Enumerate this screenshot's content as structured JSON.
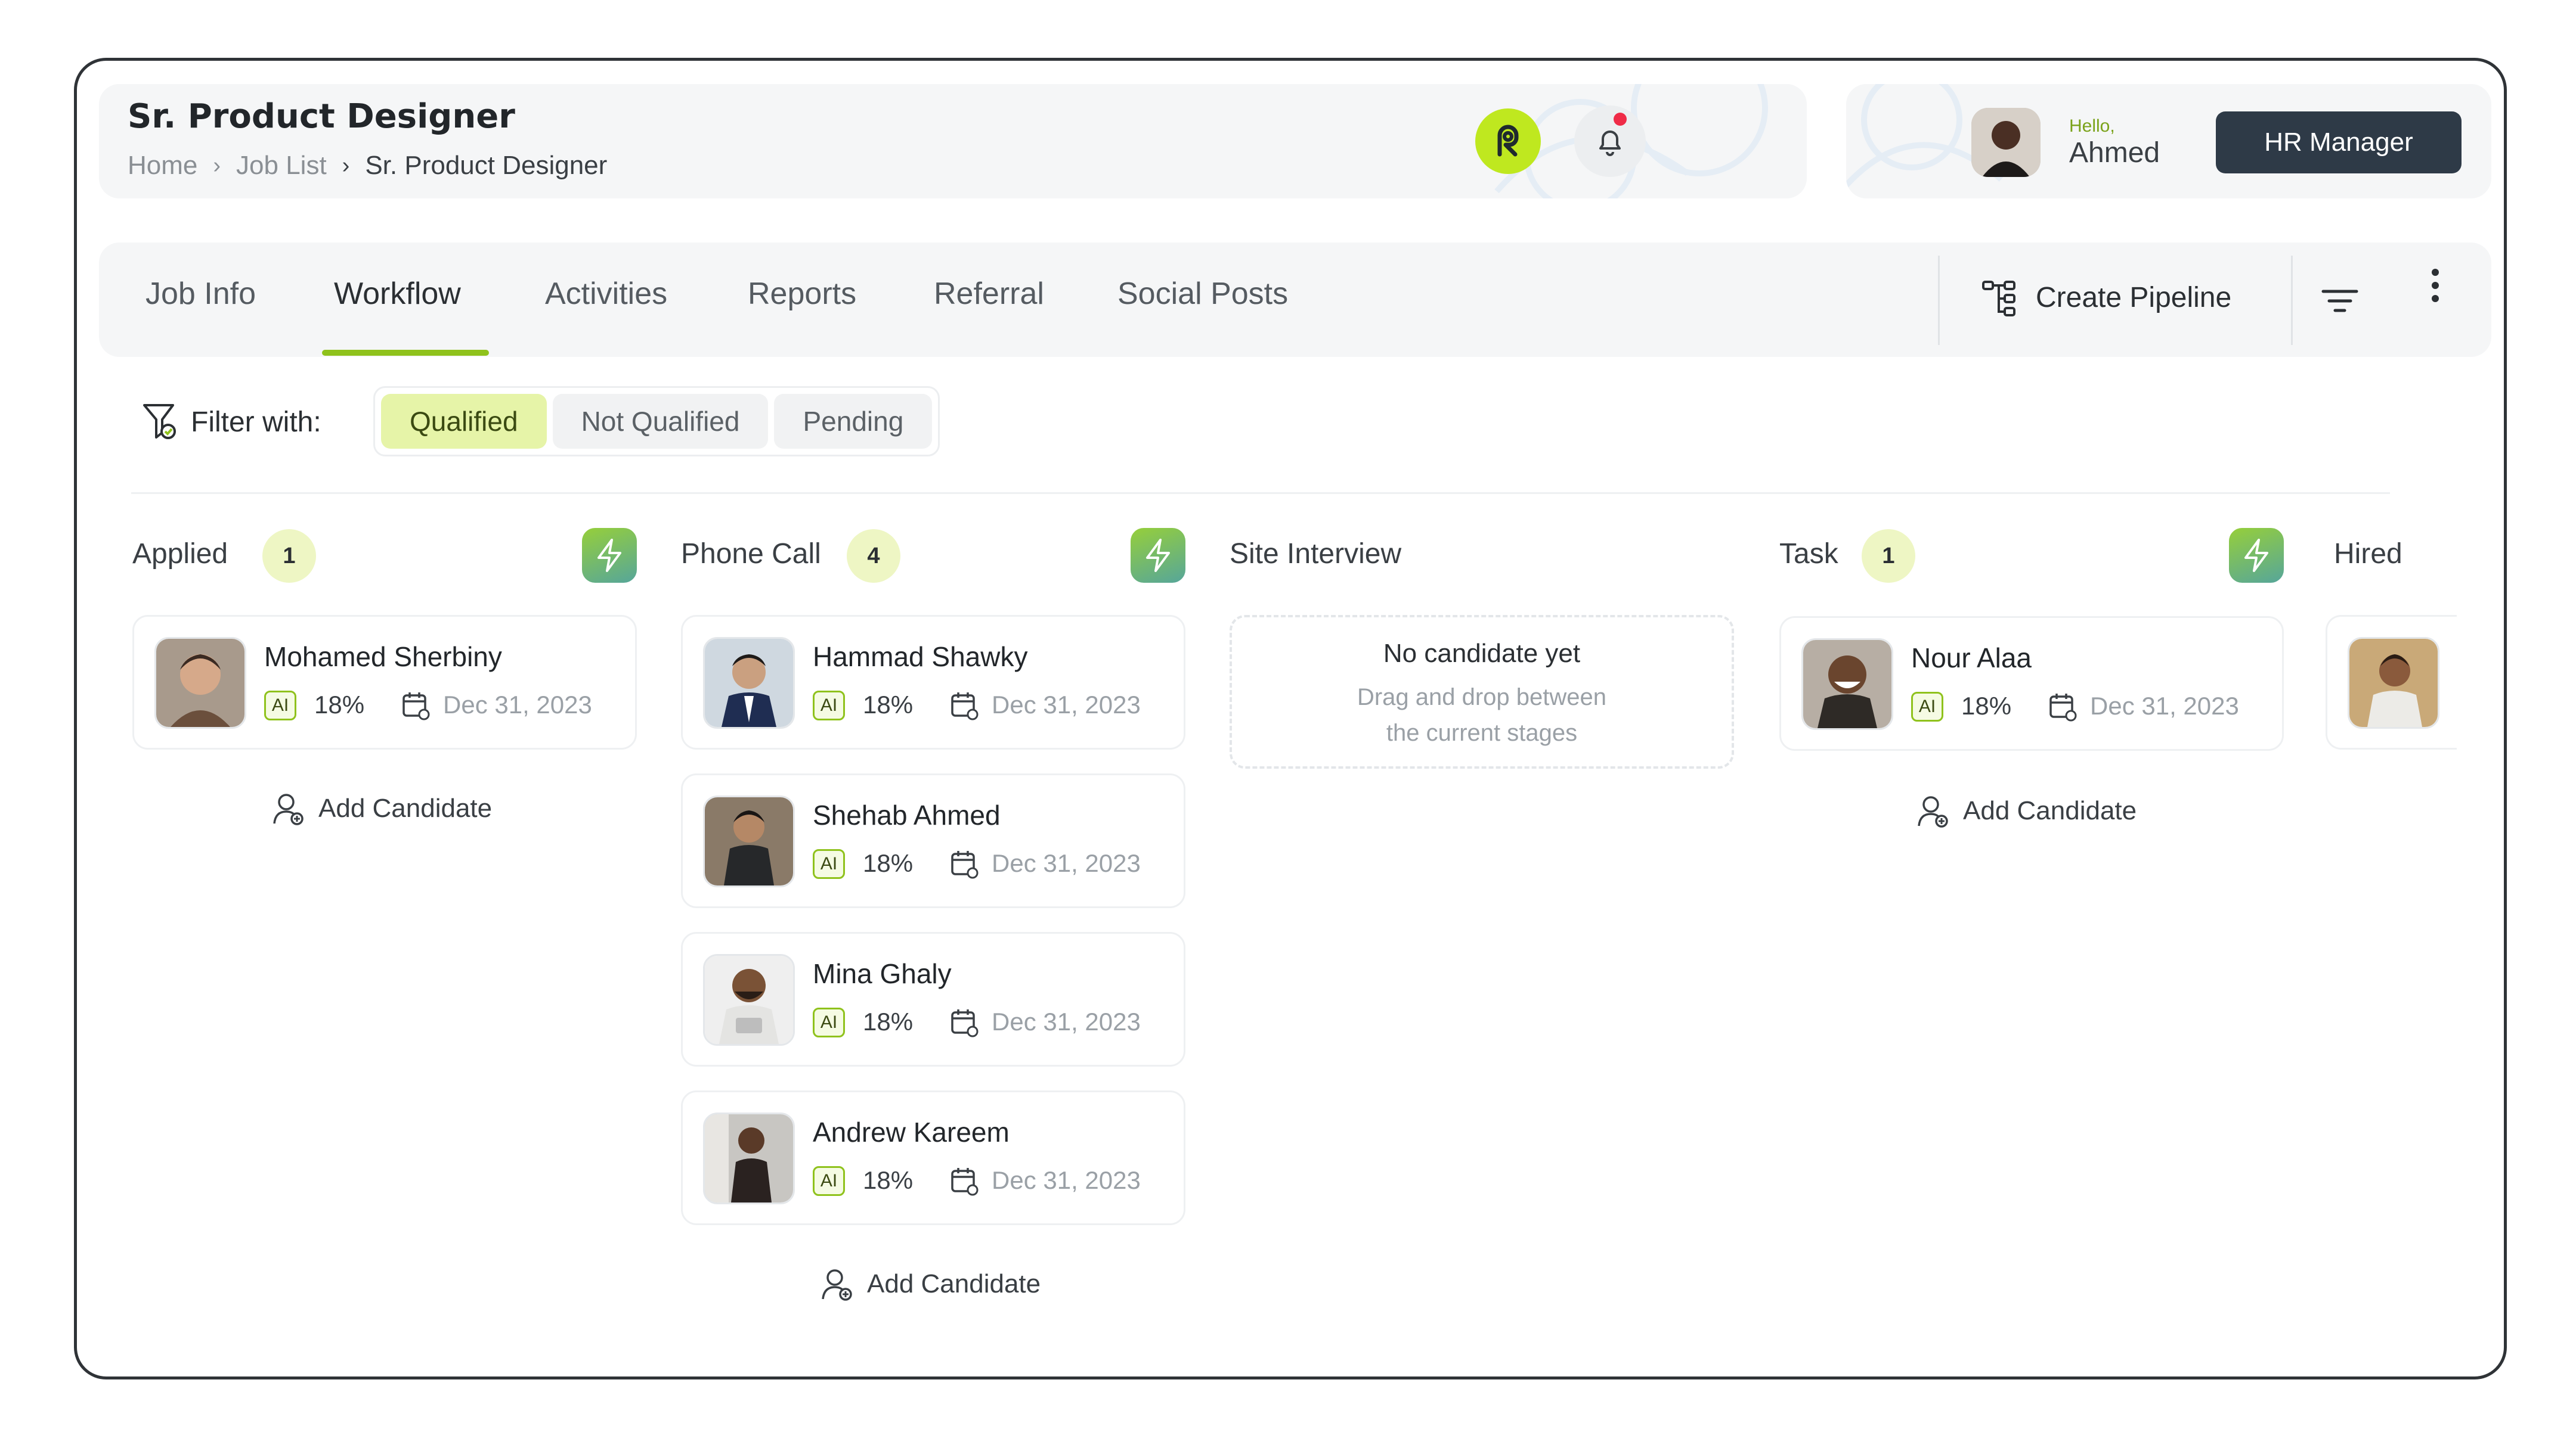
{
  "header": {
    "title": "Sr. Product Designer",
    "breadcrumb": [
      "Home",
      "Job List",
      "Sr. Product Designer"
    ]
  },
  "icons": {
    "logo": "brand-logo-icon",
    "notifications": "bell-icon",
    "notification_dot_color": "#ef2b47",
    "accent": "#8fc21c",
    "brand_lime": "#bfe81f"
  },
  "user": {
    "greeting": "Hello,",
    "name": "Ahmed",
    "role_button": "HR Manager"
  },
  "tabs": [
    {
      "label": "Job Info",
      "active": false
    },
    {
      "label": "Workflow",
      "active": true
    },
    {
      "label": "Activities",
      "active": false
    },
    {
      "label": "Reports",
      "active": false
    },
    {
      "label": "Referral",
      "active": false
    },
    {
      "label": "Social Posts",
      "active": false
    }
  ],
  "toolbar": {
    "create_pipeline": "Create Pipeline"
  },
  "filter": {
    "label": "Filter with:",
    "options": [
      "Qualified",
      "Not Qualified",
      "Pending"
    ],
    "selected": "Qualified"
  },
  "columns": [
    {
      "title": "Applied",
      "count": "1",
      "candidates": [
        {
          "name": "Mohamed Sherbiny",
          "ai": "AI",
          "score": "18%",
          "date": "Dec 31, 2023"
        }
      ],
      "add_label": "Add Candidate"
    },
    {
      "title": "Phone Call",
      "count": "4",
      "candidates": [
        {
          "name": "Hammad Shawky",
          "ai": "AI",
          "score": "18%",
          "date": "Dec 31, 2023"
        },
        {
          "name": "Shehab Ahmed",
          "ai": "AI",
          "score": "18%",
          "date": "Dec 31, 2023"
        },
        {
          "name": "Mina Ghaly",
          "ai": "AI",
          "score": "18%",
          "date": "Dec 31, 2023"
        },
        {
          "name": "Andrew Kareem",
          "ai": "AI",
          "score": "18%",
          "date": "Dec 31, 2023"
        }
      ],
      "add_label": "Add Candidate"
    },
    {
      "title": "Site Interview",
      "empty": {
        "title": "No candidate yet",
        "line1": "Drag and drop between",
        "line2": "the current stages"
      }
    },
    {
      "title": "Task",
      "count": "1",
      "candidates": [
        {
          "name": "Nour Alaa",
          "ai": "AI",
          "score": "18%",
          "date": "Dec 31, 2023"
        }
      ],
      "add_label": "Add Candidate"
    },
    {
      "title": "Hired"
    }
  ]
}
